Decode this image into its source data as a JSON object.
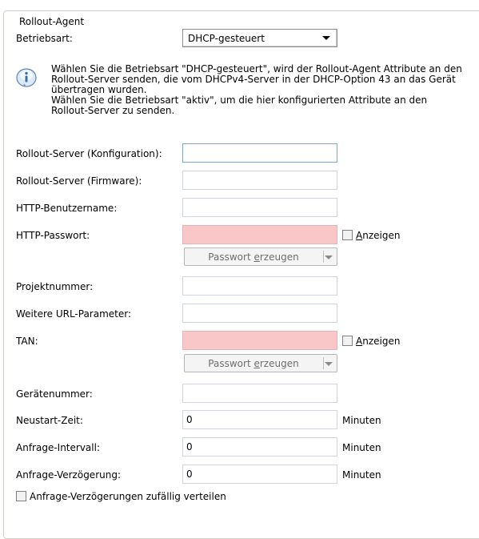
{
  "group": {
    "title": "Rollout-Agent"
  },
  "mode": {
    "label": "Betriebsart:",
    "value": "DHCP-gesteuert"
  },
  "info": {
    "icon": "info-icon",
    "lines": [
      "Wählen Sie die Betriebsart \"DHCP-gesteuert\", wird der Rollout-Agent Attribute an den",
      "Rollout-Server senden, die vom DHCPv4-Server in der DHCP-Option 43 an das Gerät",
      "übertragen wurden.",
      "Wählen Sie die Betriebsart \"aktiv\", um die hier konfigurierten Attribute an den",
      "Rollout-Server zu senden."
    ]
  },
  "fields": {
    "server_config": {
      "label": "Rollout-Server (Konfiguration):",
      "value": ""
    },
    "server_firmware": {
      "label": "Rollout-Server (Firmware):",
      "value": ""
    },
    "http_user": {
      "label": "HTTP-Benutzername:",
      "value": ""
    },
    "http_password": {
      "label": "HTTP-Passwort:",
      "value": "",
      "show_label_pre": "",
      "show_label_u": "A",
      "show_label_post": "nzeigen",
      "button_pre": "Passwort ",
      "button_u": "e",
      "button_post": "rzeugen"
    },
    "project": {
      "label": "Projektnummer:",
      "value": ""
    },
    "url_params": {
      "label": "Weitere URL-Parameter:",
      "value": ""
    },
    "tan": {
      "label": "TAN:",
      "value": "",
      "show_label_u": "A",
      "show_label_post": "nzeigen",
      "button_pre": "Passwort ",
      "button_u": "e",
      "button_post": "rzeugen"
    },
    "device_number": {
      "label": "Gerätenummer:",
      "value": ""
    },
    "restart_time": {
      "label": "Neustart-Zeit:",
      "value": "0",
      "unit": "Minuten"
    },
    "request_interval": {
      "label": "Anfrage-Intervall:",
      "value": "0",
      "unit": "Minuten"
    },
    "request_delay": {
      "label": "Anfrage-Verzögerung:",
      "value": "0",
      "unit": "Minuten"
    }
  },
  "random_delay": {
    "label": "Anfrage-Verzögerungen zufällig verteilen",
    "checked": false
  }
}
